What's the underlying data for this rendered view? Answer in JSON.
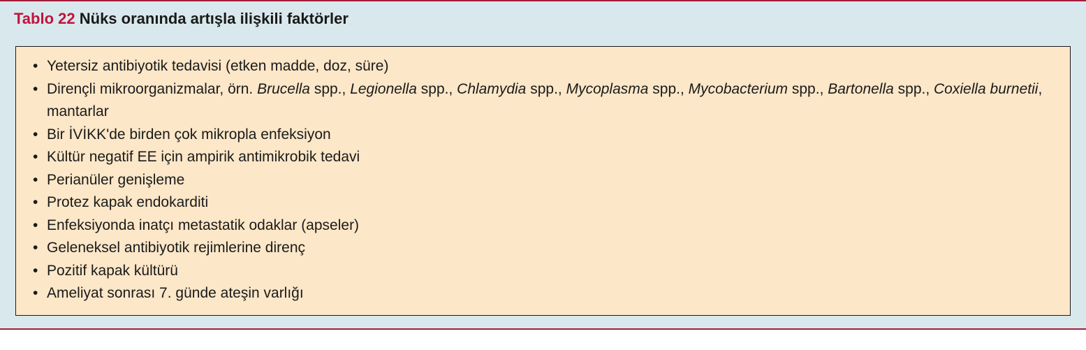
{
  "header": {
    "label": "Tablo 22",
    "title": "Nüks oranında artışla ilişkili faktörler"
  },
  "items": [
    {
      "segments": [
        {
          "text": "Yetersiz antibiyotik tedavisi (etken madde, doz, süre)"
        }
      ]
    },
    {
      "segments": [
        {
          "text": "Dirençli mikroorganizmalar, örn. "
        },
        {
          "text": "Brucella",
          "italic": true
        },
        {
          "text": " spp., "
        },
        {
          "text": "Legionella",
          "italic": true
        },
        {
          "text": " spp., "
        },
        {
          "text": "Chlamydia",
          "italic": true
        },
        {
          "text": " spp., "
        },
        {
          "text": "Mycoplasma",
          "italic": true
        },
        {
          "text": " spp., "
        },
        {
          "text": "Mycobacterium",
          "italic": true
        },
        {
          "text": " spp., "
        },
        {
          "text": "Bartonella",
          "italic": true
        },
        {
          "text": " spp., "
        },
        {
          "text": "Coxiella burnetii",
          "italic": true
        },
        {
          "text": ", mantarlar"
        }
      ]
    },
    {
      "segments": [
        {
          "text": "Bir İVİKK'de birden çok mikropla enfeksiyon"
        }
      ]
    },
    {
      "segments": [
        {
          "text": "Kültür negatif EE için ampirik antimikrobik tedavi"
        }
      ]
    },
    {
      "segments": [
        {
          "text": "Perianüler genişleme"
        }
      ]
    },
    {
      "segments": [
        {
          "text": "Protez kapak endokarditi"
        }
      ]
    },
    {
      "segments": [
        {
          "text": "Enfeksiyonda inatçı metastatik odaklar (apseler)"
        }
      ]
    },
    {
      "segments": [
        {
          "text": "Geleneksel antibiyotik rejimlerine direnç"
        }
      ]
    },
    {
      "segments": [
        {
          "text": "Pozitif kapak kültürü"
        }
      ]
    },
    {
      "segments": [
        {
          "text": "Ameliyat sonrası 7. günde ateşin varlığı"
        }
      ]
    }
  ]
}
